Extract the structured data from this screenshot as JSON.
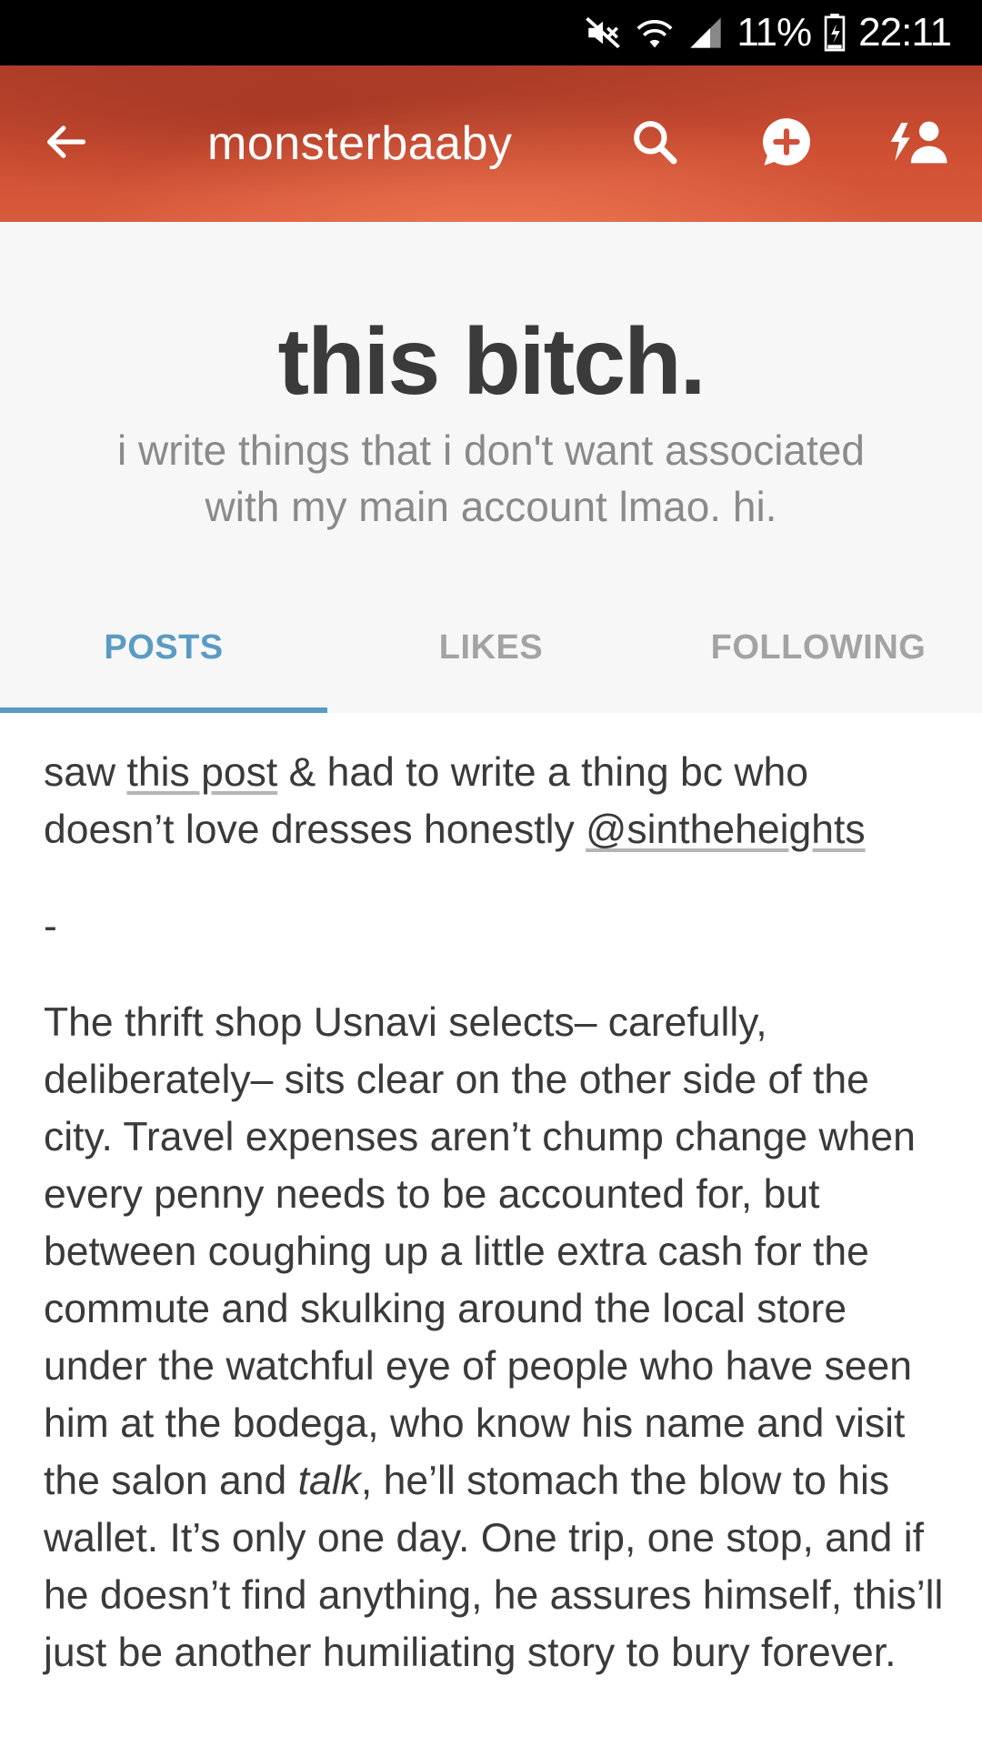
{
  "status_bar": {
    "battery": "11%",
    "time": "22:11",
    "icons": [
      "mute-icon",
      "wifi-icon",
      "signal-icon",
      "battery-icon"
    ]
  },
  "app_bar": {
    "title": "monsterbaaby",
    "icons": [
      "back-arrow-icon",
      "search-icon",
      "compose-message-icon",
      "follow-user-icon"
    ],
    "accent_color": "#d0513a"
  },
  "blog_header": {
    "title": "this bitch.",
    "description": "i write things that i don't want associated with my main account lmao. hi."
  },
  "tabs": [
    {
      "label": "POSTS",
      "active": true
    },
    {
      "label": "LIKES",
      "active": false
    },
    {
      "label": "FOLLOWING",
      "active": false
    }
  ],
  "tab_active_color": "#5a9bc5",
  "post": {
    "intro_before_link": "saw ",
    "intro_link": "this post",
    "intro_after_link": " & had to write a thing bc who doesn’t love dresses honestly ",
    "mention": "@sintheheights",
    "separator": "-",
    "body_part1": "The thrift shop Usnavi selects– carefully, deliberately– sits clear on the other side of the city. Travel expenses aren’t chump change when every penny needs to be accounted for, but between coughing up a little extra cash for the commute and skulking around the local store under the watchful eye of people who have seen him at the bodega, who know his name and visit the salon and ",
    "body_italic": "talk",
    "body_part2": ", he’ll stomach the blow to his wallet. It’s only one day. One trip, one stop, and if he doesn’t find anything, he assures himself, this’ll just be another humiliating story to bury forever."
  }
}
